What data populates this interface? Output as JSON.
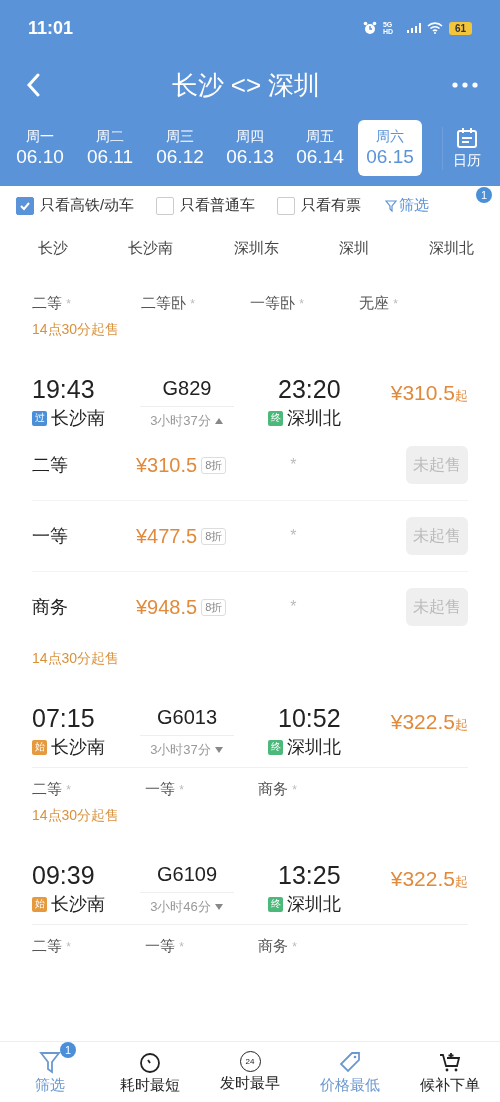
{
  "status_bar": {
    "time": "11:01",
    "network": "5G HD",
    "battery": "61"
  },
  "header": {
    "title": "长沙 <> 深圳"
  },
  "dates": [
    {
      "weekday": "周一",
      "date": "06.10",
      "selected": false
    },
    {
      "weekday": "周二",
      "date": "06.11",
      "selected": false
    },
    {
      "weekday": "周三",
      "date": "06.12",
      "selected": false
    },
    {
      "weekday": "周四",
      "date": "06.13",
      "selected": false
    },
    {
      "weekday": "周五",
      "date": "06.14",
      "selected": false
    },
    {
      "weekday": "周六",
      "date": "06.15",
      "selected": true
    }
  ],
  "calendar_label": "日历",
  "filters": [
    {
      "label": "只看高铁/动车",
      "checked": true
    },
    {
      "label": "只看普通车",
      "checked": false
    },
    {
      "label": "只看有票",
      "checked": false
    }
  ],
  "filter_button": {
    "label": "筛选",
    "badge": "1"
  },
  "stations": [
    "长沙",
    "长沙南",
    "深圳东",
    "深圳",
    "深圳北"
  ],
  "summary": {
    "seats": [
      {
        "name": "二等",
        "availability": "*"
      },
      {
        "name": "二等卧",
        "availability": "*"
      },
      {
        "name": "一等卧",
        "availability": "*"
      },
      {
        "name": "无座",
        "availability": "*"
      }
    ],
    "sale_note": "14点30分起售"
  },
  "trains": [
    {
      "depart_time": "19:43",
      "train_no": "G829",
      "arrive_time": "23:20",
      "price": "¥310.5",
      "price_suffix": "起",
      "from_tag": {
        "text": "过",
        "color": "#4a8fd8"
      },
      "from_station": "长沙南",
      "duration": "3小时37分",
      "to_tag": {
        "text": "终",
        "color": "#4cb87a"
      },
      "to_station": "深圳北",
      "expanded": true,
      "seats": [
        {
          "name": "二等",
          "price": "¥310.5",
          "discount": "8折",
          "availability": "*",
          "button": "未起售",
          "disabled": true
        },
        {
          "name": "一等",
          "price": "¥477.5",
          "discount": "8折",
          "availability": "*",
          "button": "未起售",
          "disabled": true
        },
        {
          "name": "商务",
          "price": "¥948.5",
          "discount": "8折",
          "availability": "*",
          "button": "未起售",
          "disabled": true
        }
      ],
      "sale_note": "14点30分起售"
    },
    {
      "depart_time": "07:15",
      "train_no": "G6013",
      "arrive_time": "10:52",
      "price": "¥322.5",
      "price_suffix": "起",
      "from_tag": {
        "text": "始",
        "color": "#e59a3f"
      },
      "from_station": "长沙南",
      "duration": "3小时37分",
      "to_tag": {
        "text": "终",
        "color": "#4cb87a"
      },
      "to_station": "深圳北",
      "expanded": false,
      "seats": [
        {
          "name": "二等",
          "availability": "*"
        },
        {
          "name": "一等",
          "availability": "*"
        },
        {
          "name": "商务",
          "availability": "*"
        }
      ],
      "sale_note": "14点30分起售"
    },
    {
      "depart_time": "09:39",
      "train_no": "G6109",
      "arrive_time": "13:25",
      "price": "¥322.5",
      "price_suffix": "起",
      "from_tag": {
        "text": "始",
        "color": "#e59a3f"
      },
      "from_station": "长沙南",
      "duration": "3小时46分",
      "to_tag": {
        "text": "终",
        "color": "#4cb87a"
      },
      "to_station": "深圳北",
      "expanded": false,
      "seats": [
        {
          "name": "二等",
          "availability": "*"
        },
        {
          "name": "一等",
          "availability": "*"
        },
        {
          "name": "商务",
          "availability": "*"
        }
      ]
    }
  ],
  "bottom_nav": [
    {
      "kind": "filter",
      "label": "筛选",
      "selected": true,
      "badge": "1"
    },
    {
      "kind": "timer",
      "label": "耗时最短",
      "selected": false
    },
    {
      "kind": "clock24",
      "label": "发时最早",
      "selected": false,
      "icon_text": "24"
    },
    {
      "kind": "tag",
      "label": "价格最低",
      "selected": true
    },
    {
      "kind": "cart",
      "label": "候补下单",
      "selected": false
    }
  ]
}
